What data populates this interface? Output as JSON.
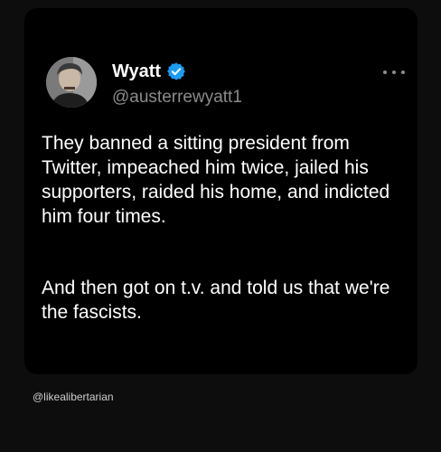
{
  "tweet": {
    "author_name": "Wyatt",
    "handle": "@austerrewyatt1",
    "verified_color": "#1d9bf0",
    "paragraph_1": "They banned a sitting president from Twitter, impeached him twice, jailed his supporters, raided his home, and indicted him four times.",
    "paragraph_2": "And then got on t.v. and told us that we're the fascists."
  },
  "icons": {
    "avatar": "profile-photo",
    "verified": "verified-badge-icon",
    "more": "more-horizontal-icon"
  },
  "watermark": {
    "text": "@likealibertarian"
  },
  "colors": {
    "background": "#0d0d0d",
    "card": "#000000",
    "text": "#ffffff",
    "muted": "#8b8b8b"
  }
}
